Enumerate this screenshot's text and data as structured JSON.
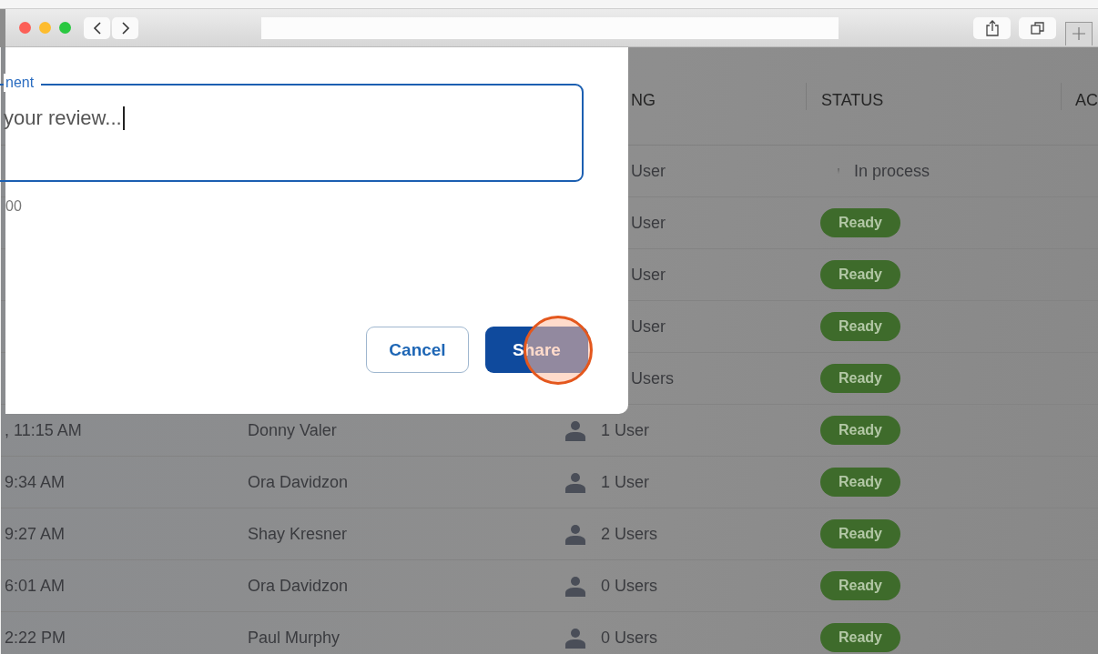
{
  "dialog": {
    "field": {
      "label": "nent",
      "value": "your review...",
      "focused": true
    },
    "counter": "00",
    "buttons": [
      {
        "label": "Cancel",
        "kind": "secondary",
        "clicked": false
      },
      {
        "label": "Share",
        "kind": "primary",
        "clicked": true
      }
    ]
  },
  "table": {
    "columns": [
      {
        "label": "NG"
      },
      {
        "label": "STATUS"
      },
      {
        "label": "AC"
      }
    ],
    "rows": [
      {
        "kind": "covered",
        "sharing": "User",
        "status": {
          "kind": "text",
          "label": "In process"
        }
      },
      {
        "kind": "covered",
        "sharing": "User",
        "status": {
          "kind": "pill",
          "label": "Ready"
        }
      },
      {
        "kind": "covered",
        "sharing": "User",
        "status": {
          "kind": "pill",
          "label": "Ready"
        }
      },
      {
        "kind": "covered",
        "sharing": "User",
        "status": {
          "kind": "pill",
          "label": "Ready"
        }
      },
      {
        "kind": "covered",
        "sharing": "Users",
        "status": {
          "kind": "pill",
          "label": "Ready"
        }
      },
      {
        "kind": "full",
        "date": ", 11:15 AM",
        "owner": "Donny Valer",
        "sharing": "1 User",
        "status": {
          "kind": "pill",
          "label": "Ready"
        }
      },
      {
        "kind": "full",
        "date": "9:34 AM",
        "owner": "Ora Davidzon",
        "sharing": "1 User",
        "status": {
          "kind": "pill",
          "label": "Ready"
        }
      },
      {
        "kind": "full",
        "date": "9:27 AM",
        "owner": "Shay Kresner",
        "sharing": "2 Users",
        "status": {
          "kind": "pill",
          "label": "Ready"
        }
      },
      {
        "kind": "full",
        "date": "6:01 AM",
        "owner": "Ora Davidzon",
        "sharing": "0 Users",
        "status": {
          "kind": "pill",
          "label": "Ready"
        }
      },
      {
        "kind": "full",
        "date": "2:22 PM",
        "owner": "Paul Murphy",
        "sharing": "0 Users",
        "status": {
          "kind": "pill",
          "label": "Ready"
        }
      }
    ]
  }
}
